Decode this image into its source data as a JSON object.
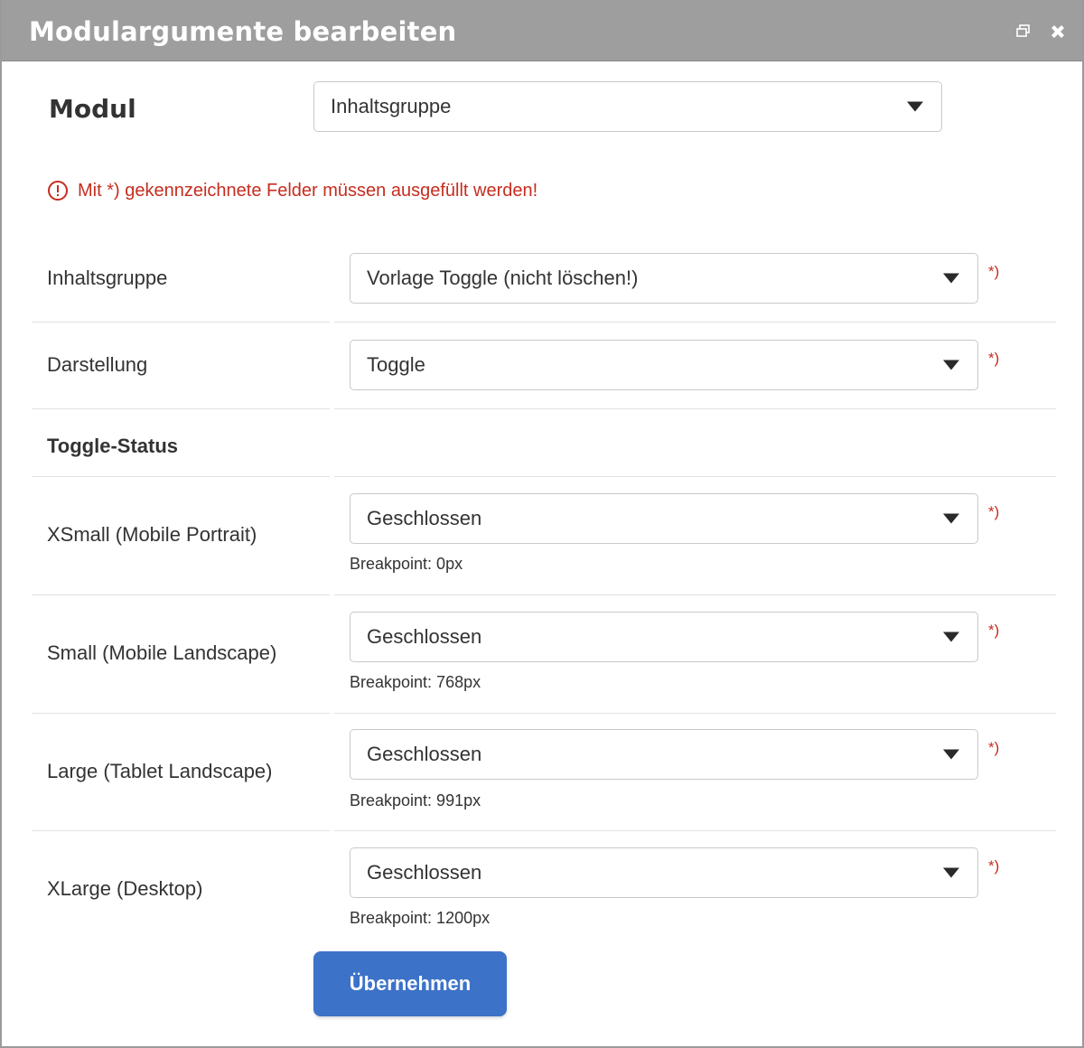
{
  "dialog": {
    "title": "Modulargumente bearbeiten",
    "icons": {
      "restore": "window-restore-icon",
      "close": "close-icon"
    }
  },
  "modul": {
    "label": "Modul",
    "selected": "Inhaltsgruppe"
  },
  "warning": {
    "text": "Mit *) gekennzeichnete Felder müssen ausgefüllt werden!",
    "icon": "alert-circle-icon",
    "color": "#c62d1f"
  },
  "fields": {
    "inhaltsgruppe": {
      "label": "Inhaltsgruppe",
      "selected": "Vorlage Toggle (nicht löschen!)",
      "required_mark": "*)"
    },
    "darstellung": {
      "label": "Darstellung",
      "selected": "Toggle",
      "required_mark": "*)"
    }
  },
  "toggle_status": {
    "heading": "Toggle-Status",
    "rows": [
      {
        "label": "XSmall (Mobile Portrait)",
        "selected": "Geschlossen",
        "required_mark": "*)",
        "hint": "Breakpoint: 0px"
      },
      {
        "label": "Small (Mobile Landscape)",
        "selected": "Geschlossen",
        "required_mark": "*)",
        "hint": "Breakpoint: 768px"
      },
      {
        "label": "Large (Tablet Landscape)",
        "selected": "Geschlossen",
        "required_mark": "*)",
        "hint": "Breakpoint: 991px"
      },
      {
        "label": "XLarge (Desktop)",
        "selected": "Geschlossen",
        "required_mark": "*)",
        "hint": "Breakpoint: 1200px"
      }
    ]
  },
  "actions": {
    "submit_label": "Übernehmen"
  },
  "colors": {
    "titlebar": "#9e9e9e",
    "accent": "#3c72c8",
    "error": "#c62d1f"
  }
}
